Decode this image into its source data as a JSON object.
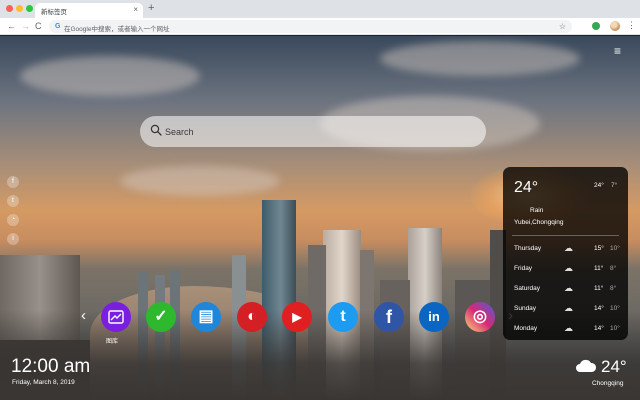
{
  "browser": {
    "tab_title": "新标签页",
    "tab_close": "×",
    "new_tab": "+",
    "address_placeholder": "在Google中搜索，或者输入一个网址",
    "nav": {
      "back": "←",
      "forward": "→",
      "reload": "C"
    },
    "menu_glyph": "⋮",
    "bookmark_glyph": "☆"
  },
  "page": {
    "menu_glyph": "≡",
    "search": {
      "placeholder": "Search"
    },
    "social": [
      {
        "icon": "facebook-icon",
        "glyph": "f"
      },
      {
        "icon": "twitter-icon",
        "glyph": "t"
      },
      {
        "icon": "share-icon",
        "glyph": "◔"
      },
      {
        "icon": "info-icon",
        "glyph": "i"
      }
    ],
    "dock": {
      "prev": "‹",
      "next": "›",
      "apps": [
        {
          "name": "gallery-icon",
          "glyph": "↗",
          "color": "#7a1fe0",
          "label": "图库"
        },
        {
          "name": "tasks-icon",
          "glyph": "✓",
          "color": "#2db82d"
        },
        {
          "name": "notes-icon",
          "glyph": "▤",
          "color": "#1f86d9"
        },
        {
          "name": "speedtest-icon",
          "glyph": "◐",
          "color": "#d41f24"
        },
        {
          "name": "youtube-icon",
          "glyph": "▶",
          "color": "#e02020"
        },
        {
          "name": "twitter-icon",
          "glyph": "t",
          "color": "#1d9bf0"
        },
        {
          "name": "facebook-icon",
          "glyph": "f",
          "color": "#2f55a7"
        },
        {
          "name": "linkedin-icon",
          "glyph": "in",
          "color": "#0a66c2"
        },
        {
          "name": "instagram-icon",
          "glyph": "◎",
          "color": "#d6249f"
        }
      ]
    },
    "clock": {
      "time": "12:00 am",
      "date": "Friday, March 8, 2019"
    },
    "weather": {
      "current_temp": "24°",
      "today_high": "24°",
      "today_low": "7°",
      "condition": "Rain",
      "location": "Yubei,Chongqing",
      "forecast": [
        {
          "day": "Thursday",
          "icon": "cloud-icon",
          "high": "15°",
          "low": "10°"
        },
        {
          "day": "Friday",
          "icon": "cloud-icon",
          "high": "11°",
          "low": "8°"
        },
        {
          "day": "Saturday",
          "icon": "cloud-icon",
          "high": "11°",
          "low": "8°"
        },
        {
          "day": "Sunday",
          "icon": "cloud-icon",
          "high": "14°",
          "low": "10°"
        },
        {
          "day": "Monday",
          "icon": "cloud-icon",
          "high": "14°",
          "low": "10°"
        }
      ],
      "corner_temp": "24°",
      "corner_city": "Chongqing"
    }
  }
}
